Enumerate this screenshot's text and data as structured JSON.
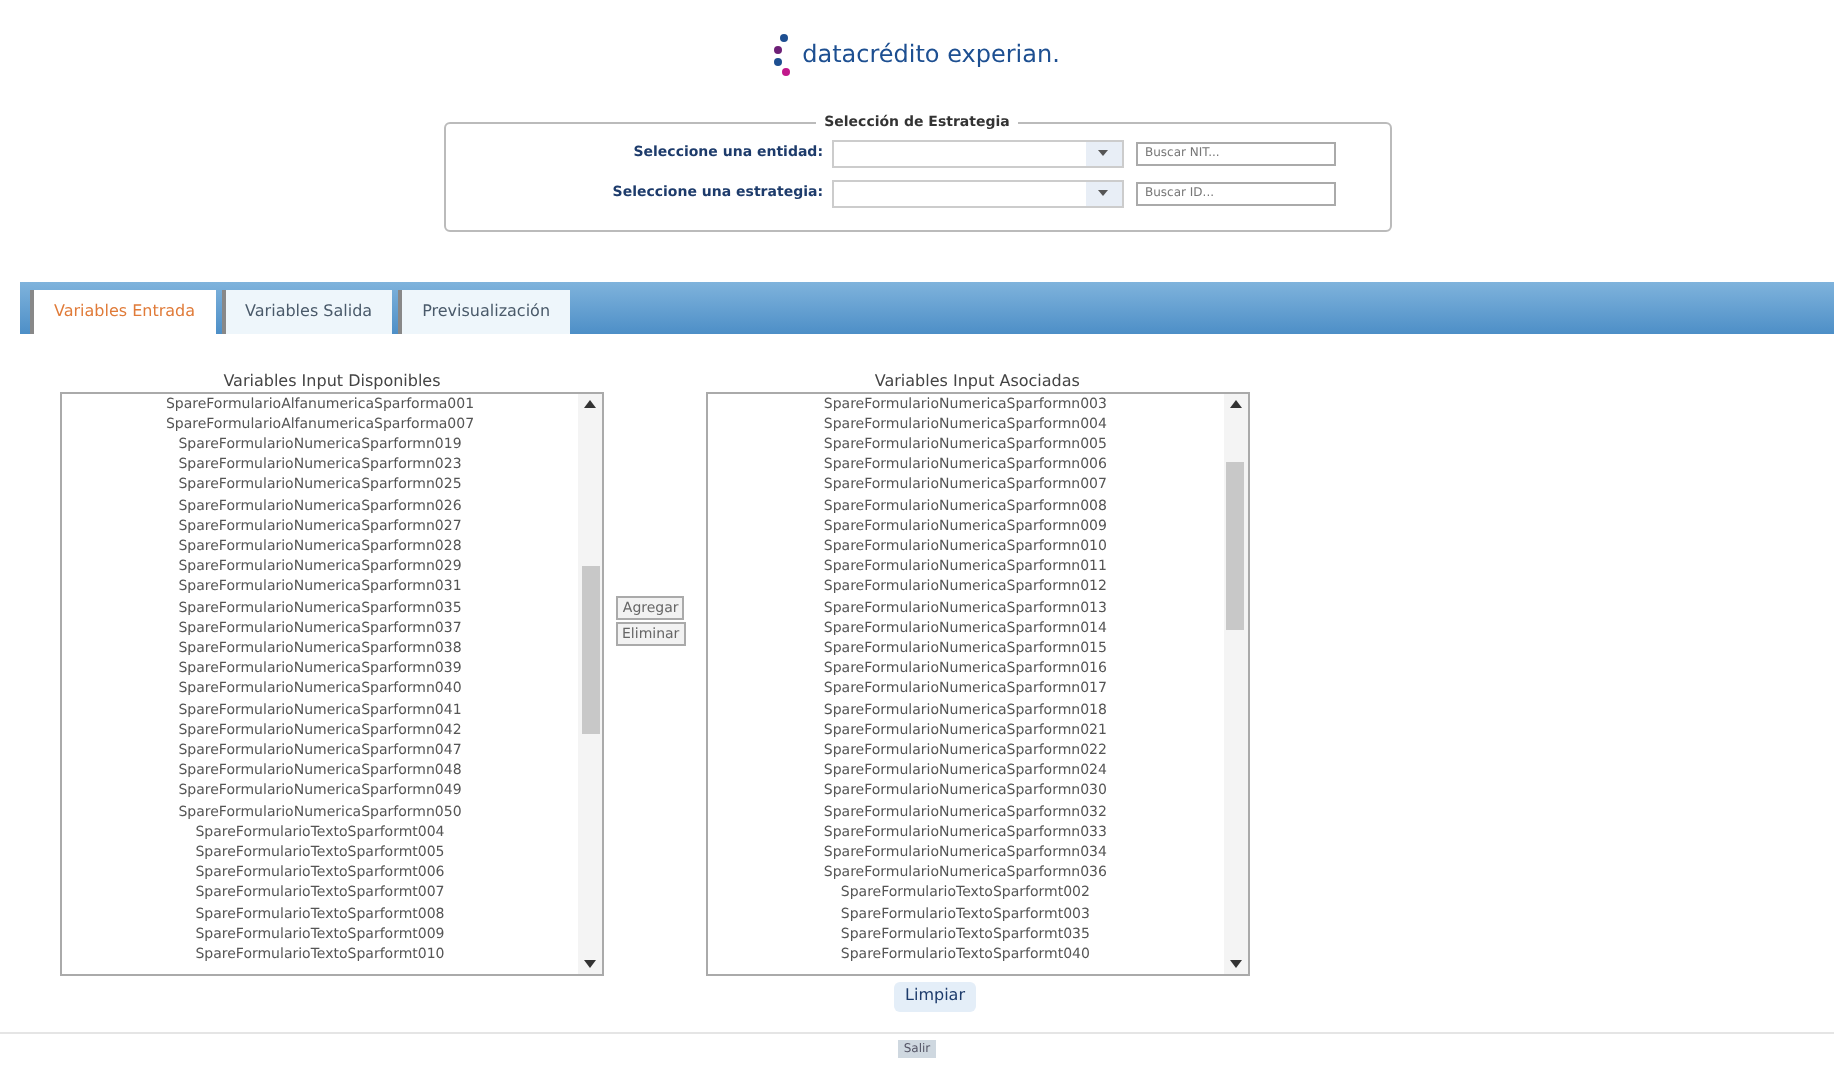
{
  "logo": {
    "text": "datacrédito experian."
  },
  "strategy": {
    "legend": "Selección de Estrategia",
    "rows": [
      {
        "label": "Seleccione una entidad:",
        "search": {
          "placeholder": "Buscar NIT..."
        }
      },
      {
        "label": "Seleccione una estrategia:",
        "search": {
          "placeholder": "Buscar ID..."
        }
      }
    ]
  },
  "tabs": [
    {
      "label": "Variables Entrada",
      "selected": true
    },
    {
      "label": "Variables Salida",
      "selected": false
    },
    {
      "label": "Previsualización",
      "selected": false
    }
  ],
  "available": {
    "title": "Variables Input Disponibles",
    "items": [
      "SpareFormularioAlfanumericaSparforma001",
      "SpareFormularioAlfanumericaSparforma007",
      "SpareFormularioNumericaSparformn019",
      "SpareFormularioNumericaSparformn023",
      "SpareFormularioNumericaSparformn025",
      "SpareFormularioNumericaSparformn026",
      "SpareFormularioNumericaSparformn027",
      "SpareFormularioNumericaSparformn028",
      "SpareFormularioNumericaSparformn029",
      "SpareFormularioNumericaSparformn031",
      "SpareFormularioNumericaSparformn035",
      "SpareFormularioNumericaSparformn037",
      "SpareFormularioNumericaSparformn038",
      "SpareFormularioNumericaSparformn039",
      "SpareFormularioNumericaSparformn040",
      "SpareFormularioNumericaSparformn041",
      "SpareFormularioNumericaSparformn042",
      "SpareFormularioNumericaSparformn047",
      "SpareFormularioNumericaSparformn048",
      "SpareFormularioNumericaSparformn049",
      "SpareFormularioNumericaSparformn050",
      "SpareFormularioTextoSparformt004",
      "SpareFormularioTextoSparformt005",
      "SpareFormularioTextoSparformt006",
      "SpareFormularioTextoSparformt007",
      "SpareFormularioTextoSparformt008",
      "SpareFormularioTextoSparformt009",
      "SpareFormularioTextoSparformt010"
    ]
  },
  "actions": [
    "Agregar",
    "Eliminar"
  ],
  "associated": {
    "title": "Variables Input Asociadas",
    "items": [
      "SpareFormularioNumericaSparformn003",
      "SpareFormularioNumericaSparformn004",
      "SpareFormularioNumericaSparformn005",
      "SpareFormularioNumericaSparformn006",
      "SpareFormularioNumericaSparformn007",
      "SpareFormularioNumericaSparformn008",
      "SpareFormularioNumericaSparformn009",
      "SpareFormularioNumericaSparformn010",
      "SpareFormularioNumericaSparformn011",
      "SpareFormularioNumericaSparformn012",
      "SpareFormularioNumericaSparformn013",
      "SpareFormularioNumericaSparformn014",
      "SpareFormularioNumericaSparformn015",
      "SpareFormularioNumericaSparformn016",
      "SpareFormularioNumericaSparformn017",
      "SpareFormularioNumericaSparformn018",
      "SpareFormularioNumericaSparformn021",
      "SpareFormularioNumericaSparformn022",
      "SpareFormularioNumericaSparformn024",
      "SpareFormularioNumericaSparformn030",
      "SpareFormularioNumericaSparformn032",
      "SpareFormularioNumericaSparformn033",
      "SpareFormularioNumericaSparformn034",
      "SpareFormularioNumericaSparformn036",
      "SpareFormularioTextoSparformt002",
      "SpareFormularioTextoSparformt003",
      "SpareFormularioTextoSparformt035",
      "SpareFormularioTextoSparformt040"
    ]
  },
  "clear_button": "Limpiar",
  "exit_button": "Salir"
}
